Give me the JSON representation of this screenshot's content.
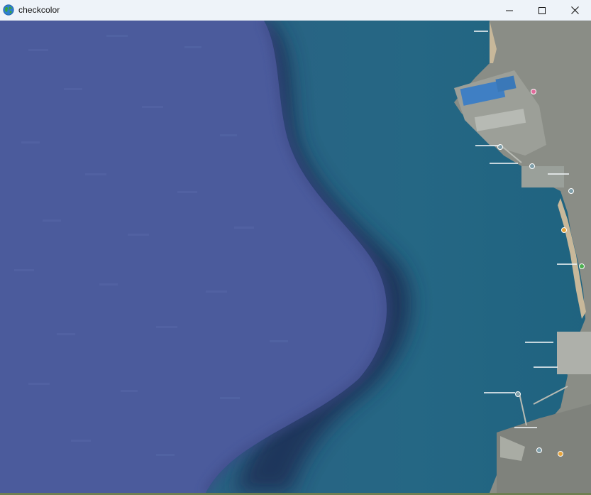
{
  "window": {
    "title": "checkcolor",
    "icon": "globe-icon"
  },
  "caption": {
    "minimize_icon": "minimize-icon",
    "maximize_icon": "maximize-icon",
    "close_icon": "close-icon"
  },
  "map": {
    "view": "satellite",
    "colors": {
      "overlay_blue": "#4b5b9c",
      "sea": "#27617f",
      "land": "#8d8f86"
    }
  }
}
